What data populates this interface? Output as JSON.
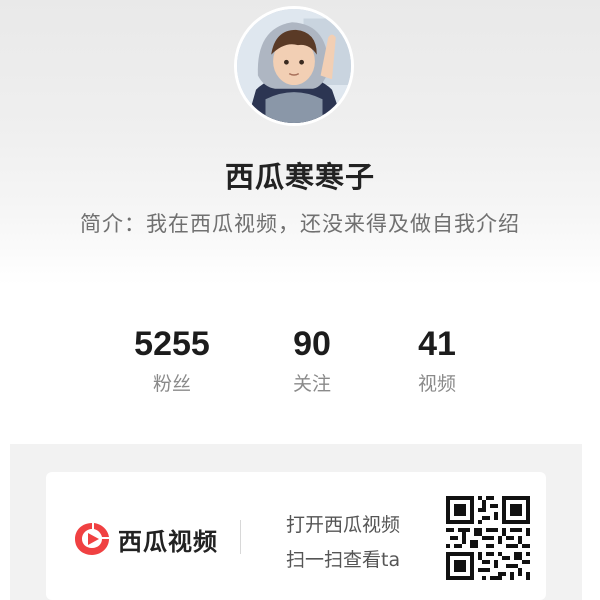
{
  "profile": {
    "nickname": "西瓜寒寒子",
    "bio": "简介：我在西瓜视频，还没来得及做自我介绍"
  },
  "stats": [
    {
      "value": "5255",
      "label": "粉丝"
    },
    {
      "value": "90",
      "label": "关注"
    },
    {
      "value": "41",
      "label": "视频"
    }
  ],
  "promo": {
    "logo_text": "西瓜视频",
    "line1": "打开西瓜视频",
    "line2": "扫一扫查看ta"
  },
  "icons": {
    "logo": "xigua-video-logo-icon",
    "qr": "qr-code-icon"
  },
  "colors": {
    "brand": "#f04142",
    "text_primary": "#222222",
    "text_secondary": "#8a8a8a"
  }
}
